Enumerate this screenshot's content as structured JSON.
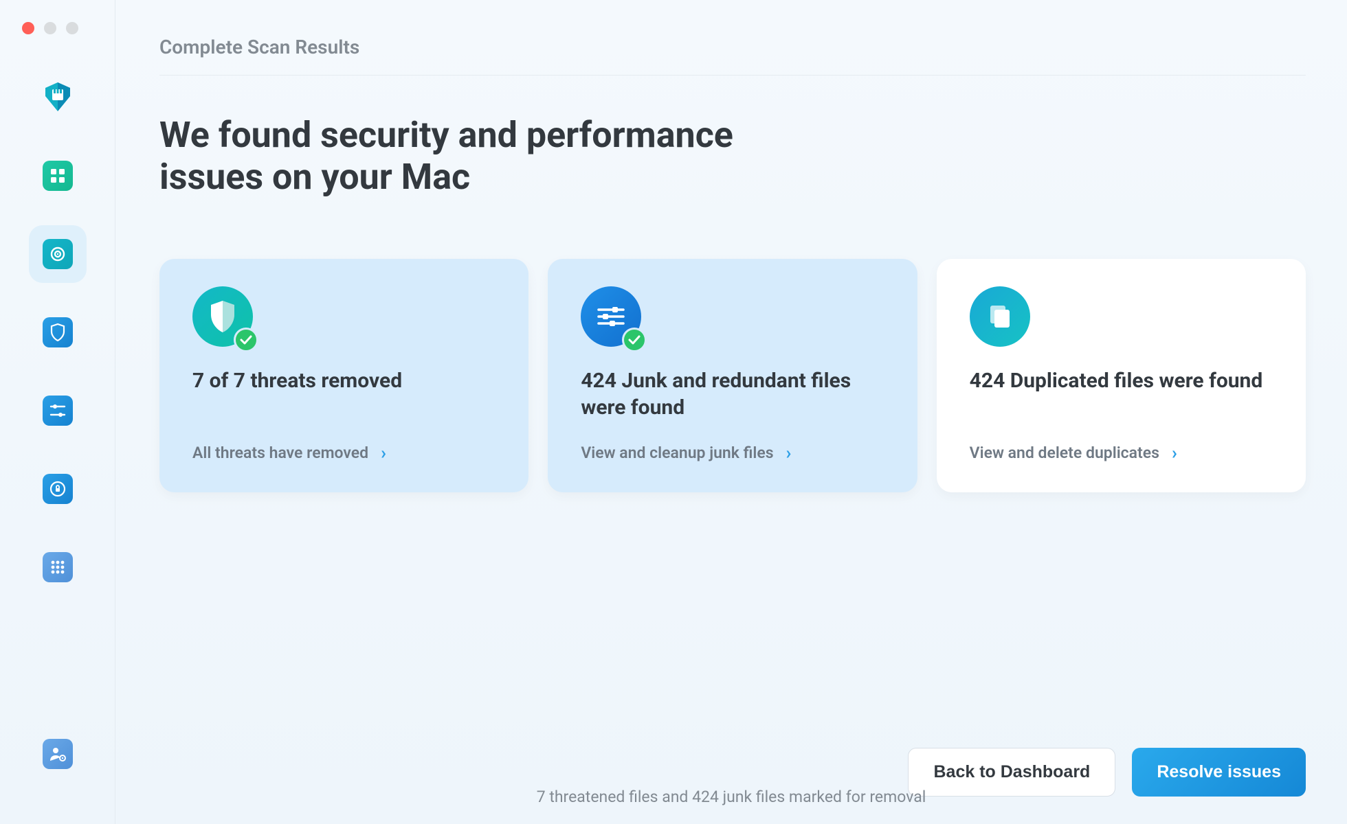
{
  "header": {
    "subtitle": "Complete Scan Results",
    "headline": "We found security and performance issues on your Mac"
  },
  "sidebar": {
    "items": [
      {
        "name": "logo",
        "icon": "castle-shield"
      },
      {
        "name": "dashboard",
        "icon": "grid"
      },
      {
        "name": "scan",
        "icon": "target",
        "active": true
      },
      {
        "name": "protection",
        "icon": "shield"
      },
      {
        "name": "tuneup",
        "icon": "sliders"
      },
      {
        "name": "privacy",
        "icon": "lock"
      },
      {
        "name": "apps",
        "icon": "apps-grid"
      },
      {
        "name": "settings",
        "icon": "user-gear"
      }
    ]
  },
  "cards": [
    {
      "icon": "shield-check",
      "badge": true,
      "style": "blue",
      "title": "7 of 7 threats removed",
      "action": "All threats have removed"
    },
    {
      "icon": "sliders-check",
      "badge": true,
      "style": "blue",
      "title": "424 Junk and redundant files were found",
      "action": "View and cleanup junk files"
    },
    {
      "icon": "duplicate",
      "badge": false,
      "style": "white",
      "title": "424 Duplicated files were found",
      "action": "View and delete duplicates"
    }
  ],
  "footer": {
    "back": "Back to Dashboard",
    "resolve": "Resolve issues",
    "status": "7 threatened files and 424 junk files marked for removal"
  }
}
